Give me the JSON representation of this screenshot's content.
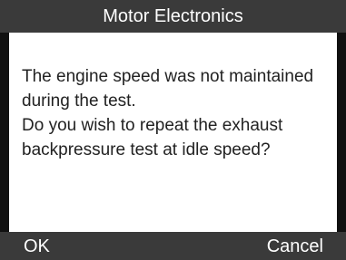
{
  "header": {
    "title": "Motor Electronics"
  },
  "dialog": {
    "lines": [
      "The engine speed was not maintained",
      "during the test.",
      "Do you wish to repeat the exhaust",
      "backpressure test at idle speed?"
    ]
  },
  "softkeys": {
    "left_label": "OK",
    "right_label": "Cancel"
  },
  "colors": {
    "bar_background": "#3a3a3a",
    "content_background": "#ffffff",
    "text": "#222222"
  }
}
